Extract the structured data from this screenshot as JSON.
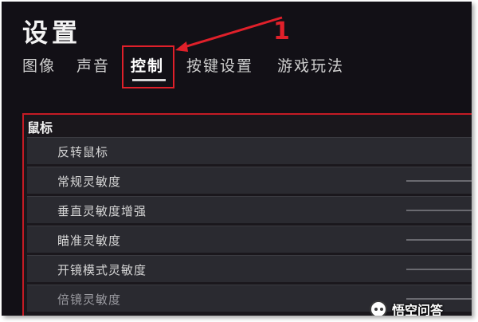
{
  "page": {
    "title": "设置"
  },
  "tabs": [
    {
      "label": "图像"
    },
    {
      "label": "声音"
    },
    {
      "label": "控制",
      "active": true
    },
    {
      "label": "按键设置"
    },
    {
      "label": "游戏玩法"
    }
  ],
  "annotation": {
    "number": "1",
    "color": "#e0202a"
  },
  "section": {
    "header": "鼠标",
    "rows": [
      {
        "label": "反转鼠标"
      },
      {
        "label": "常规灵敏度"
      },
      {
        "label": "垂直灵敏度增强"
      },
      {
        "label": "瞄准灵敏度"
      },
      {
        "label": "开镜模式灵敏度"
      },
      {
        "label": "倍镜灵敏度"
      }
    ]
  },
  "watermark": {
    "text": "悟空问答"
  }
}
